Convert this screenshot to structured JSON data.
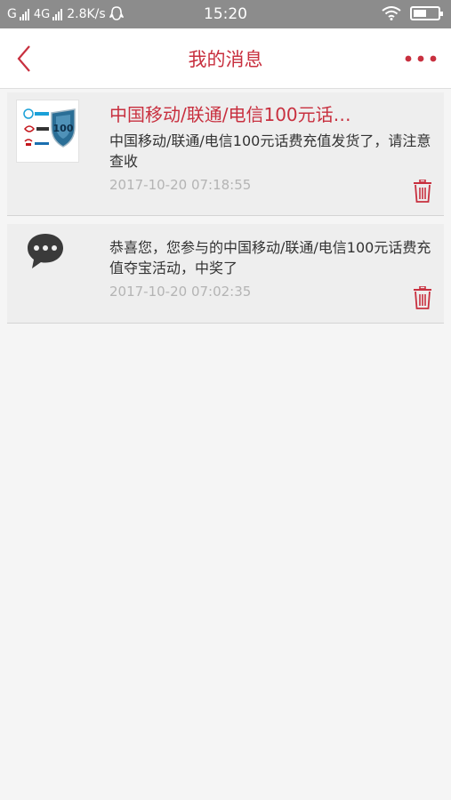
{
  "status_bar": {
    "carrier_g": "G",
    "carrier_4g": "4G",
    "speed": "2.8K/s",
    "time": "15:20"
  },
  "header": {
    "title": "我的消息",
    "back_icon": "chevron-left-icon",
    "more_icon": "more-dots-icon"
  },
  "messages": [
    {
      "thumbnail": "carrier-100-recharge-thumbnail",
      "title": "中国移动/联通/电信100元话…",
      "body": "中国移动/联通/电信100元话费充值发货了，请注意查收",
      "time": "2017-10-20 07:18:55",
      "delete_icon": "trash-icon"
    },
    {
      "thumbnail": "chat-bubble-icon",
      "body": "恭喜您，您参与的中国移动/联通/电信100元话费充值夺宝活动，中奖了",
      "time": "2017-10-20 07:02:35",
      "delete_icon": "trash-icon"
    }
  ],
  "colors": {
    "accent": "#c8303f",
    "status_bar": "#8c8c8c",
    "card_bg": "#eeeeee",
    "page_bg": "#f5f5f5",
    "time_text": "#b4b4b4"
  }
}
